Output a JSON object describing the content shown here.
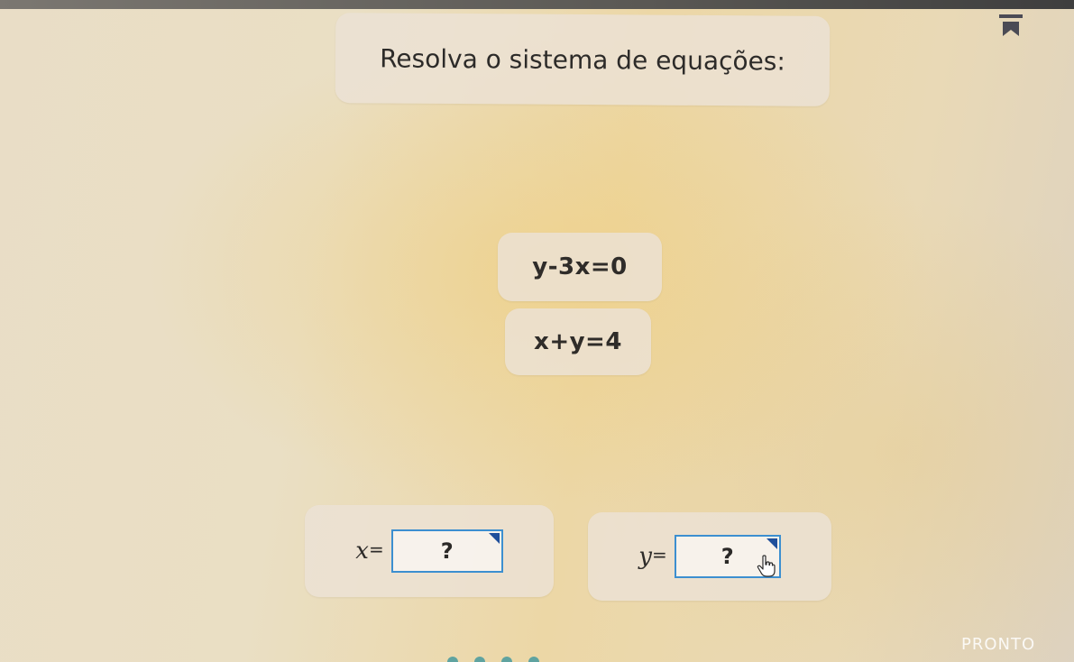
{
  "instruction": "Resolva o sistema de equações:",
  "equations": [
    {
      "text": "y-3x=0"
    },
    {
      "text": "x+y=4"
    }
  ],
  "answers": [
    {
      "variable": "x",
      "equals": "=",
      "placeholder": "?"
    },
    {
      "variable": "y",
      "equals": "=",
      "placeholder": "?"
    }
  ],
  "submit_label": "PRONTO",
  "icons": {
    "bookmark": "bookmark-icon",
    "cursor": "hand-pointer-icon",
    "dropdown_corner": "corner-triangle-icon"
  },
  "colors": {
    "input_border": "#3c8fd0",
    "corner_marker": "#1f4f9b"
  }
}
